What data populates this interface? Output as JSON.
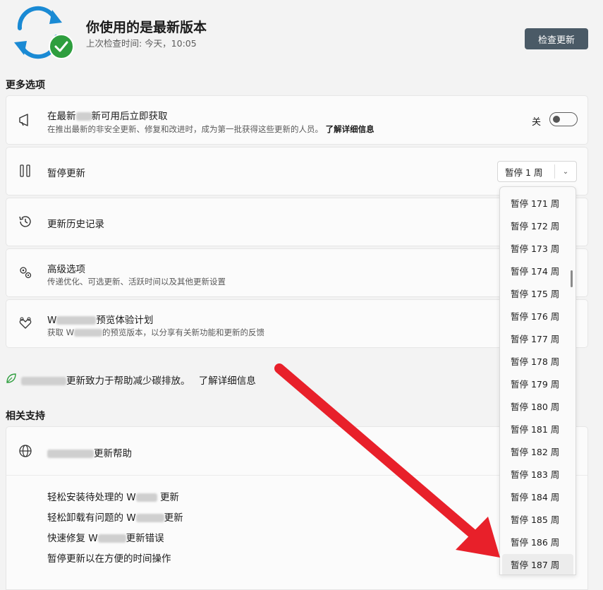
{
  "header": {
    "title": "你使用的是最新版本",
    "last_checked": "上次检查时间: 今天，10:05",
    "check_button": "检查更新"
  },
  "more_options": {
    "label": "更多选项",
    "early_updates": {
      "title_prefix": "在最新",
      "title_suffix": "新可用后立即获取",
      "subtitle": "在推出最新的非安全更新、修复和改进时，成为第一批获得这些更新的人员。",
      "link": "了解详细信息",
      "toggle_label": "关",
      "toggle_on": false
    },
    "pause_updates": {
      "title": "暂停更新",
      "selected": "暂停 1 周"
    },
    "history": {
      "title": "更新历史记录"
    },
    "advanced": {
      "title": "高级选项",
      "subtitle": "传递优化、可选更新、活跃时间以及其他更新设置"
    },
    "insider": {
      "title_prefix": "W",
      "title_suffix": "预览体验计划",
      "subtitle_prefix": "获取 W",
      "subtitle_suffix": "的预览版本，以分享有关新功能和更新的反馈"
    }
  },
  "eco": {
    "text": "更新致力于帮助减少碳排放。",
    "link": "了解详细信息"
  },
  "related_support": {
    "label": "相关支持",
    "help_title": "更新帮助",
    "links": [
      {
        "prefix": "轻松安装待处理的 W",
        "suffix": "更新"
      },
      {
        "prefix": "轻松卸载有问题的 W",
        "suffix": "更新"
      },
      {
        "prefix": "快速修复 W",
        "suffix": "更新错误"
      },
      {
        "prefix": "暂停更新以在方便的时间操作",
        "suffix": ""
      }
    ]
  },
  "dropdown": {
    "options": [
      "暂停 171 周",
      "暂停 172 周",
      "暂停 173 周",
      "暂停 174 周",
      "暂停 175 周",
      "暂停 176 周",
      "暂停 177 周",
      "暂停 178 周",
      "暂停 179 周",
      "暂停 180 周",
      "暂停 181 周",
      "暂停 182 周",
      "暂停 183 周",
      "暂停 184 周",
      "暂停 185 周",
      "暂停 186 周",
      "暂停 187 周"
    ],
    "highlighted": "暂停 187 周"
  },
  "colors": {
    "accent_button": "#4a5a66",
    "check_badge": "#2e9e3e",
    "sync_blue": "#1a8ad4",
    "annotation_arrow": "#e8202a"
  }
}
